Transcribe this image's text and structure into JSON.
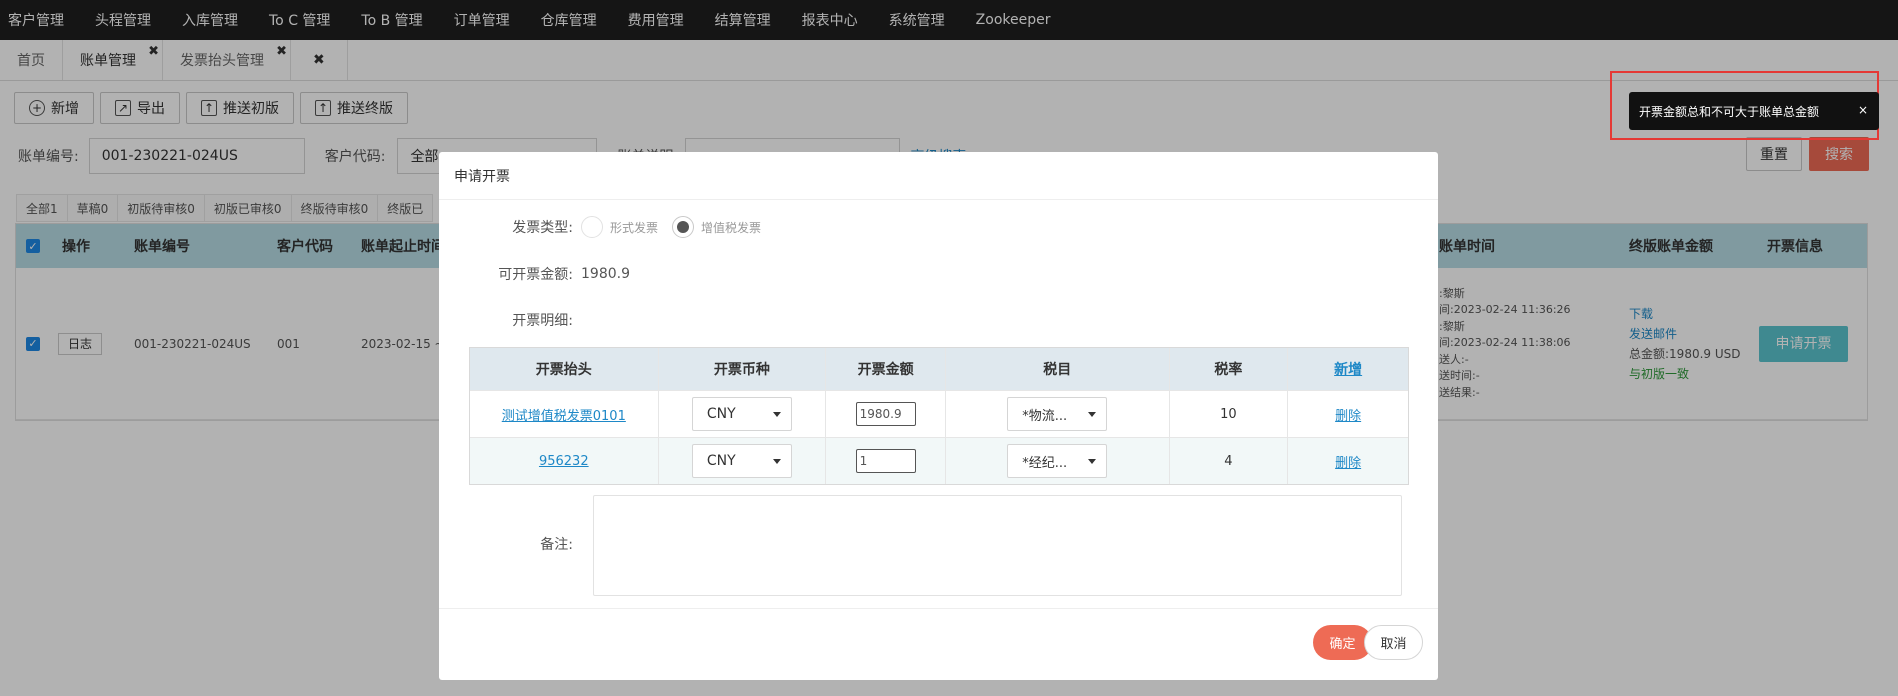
{
  "topnav": {
    "items": [
      "客户管理",
      "头程管理",
      "入库管理",
      "To C 管理",
      "To B 管理",
      "订单管理",
      "仓库管理",
      "费用管理",
      "结算管理",
      "报表中心",
      "系统管理",
      "Zookeeper"
    ]
  },
  "tabs": [
    {
      "label": "首页"
    },
    {
      "label": "账单管理",
      "close": "✖"
    },
    {
      "label": "发票抬头管理",
      "close": "✖"
    }
  ],
  "tabs_close_all": "✖",
  "toolbar": {
    "add": "新增",
    "export": "导出",
    "push_draft": "推送初版",
    "push_final": "推送终版"
  },
  "filters": {
    "bill_no_label": "账单编号:",
    "bill_no_value": "001-230221-024US",
    "customer_label": "客户代码:",
    "customer_value": "全部",
    "bill_desc_label": "账单说明",
    "advanced_label": "高级搜索"
  },
  "actions": {
    "reset": "重置",
    "search": "搜索"
  },
  "status_tabs": [
    "全部1",
    "草稿0",
    "初版待审核0",
    "初版已审核0",
    "终版待审核0",
    "终版已"
  ],
  "grid": {
    "headers": {
      "op": "操作",
      "bill_no": "账单编号",
      "customer": "客户代码",
      "period": "账单起止时间",
      "bill_time": "账单时间",
      "final_amount": "终版账单金额",
      "invoice_info": "开票信息"
    },
    "row": {
      "log_btn": "日志",
      "bill_no": "001-230221-024US",
      "customer": "001",
      "period": "2023-02-15 ~",
      "time_lines": [
        ":黎斯",
        "间:2023-02-24 11:36:26",
        ":黎斯",
        "间:2023-02-24 11:38:06",
        "送人:-",
        "送时间:-",
        "送结果:-"
      ],
      "download": "下载",
      "send_mail": "发送邮件",
      "total": "总金额:1980.9 USD",
      "consistent": "与初版一致",
      "apply_btn": "申请开票"
    }
  },
  "dialog": {
    "title": "申请开票",
    "invoice_type_label": "发票类型:",
    "type_options": [
      "形式发票",
      "增值税发票"
    ],
    "selected_type": "增值税发票",
    "available_label": "可开票金额:",
    "available_value": "1980.9",
    "detail_label": "开票明细:",
    "table": {
      "headers": [
        "开票抬头",
        "开票币种",
        "开票金额",
        "税目",
        "税率"
      ],
      "add_link": "新增",
      "rows": [
        {
          "title": "测试增值税发票0101",
          "currency": "CNY",
          "amount": "1980.9",
          "tax_item": "*物流...",
          "rate": "10",
          "delete": "删除"
        },
        {
          "title": "956232",
          "currency": "CNY",
          "amount": "1",
          "tax_item": "*经纪...",
          "rate": "4",
          "delete": "删除"
        }
      ]
    },
    "remark_label": "备注:",
    "remark_value": "",
    "confirm": "确定",
    "cancel": "取消"
  },
  "toast": {
    "message": "开票金额总和不可大于账单总金额",
    "close": "×"
  },
  "colors": {
    "accent": "#ee6b55",
    "link": "#1e88c7",
    "toast_frame": "#e53935",
    "grid_header": "#b8dde6"
  }
}
